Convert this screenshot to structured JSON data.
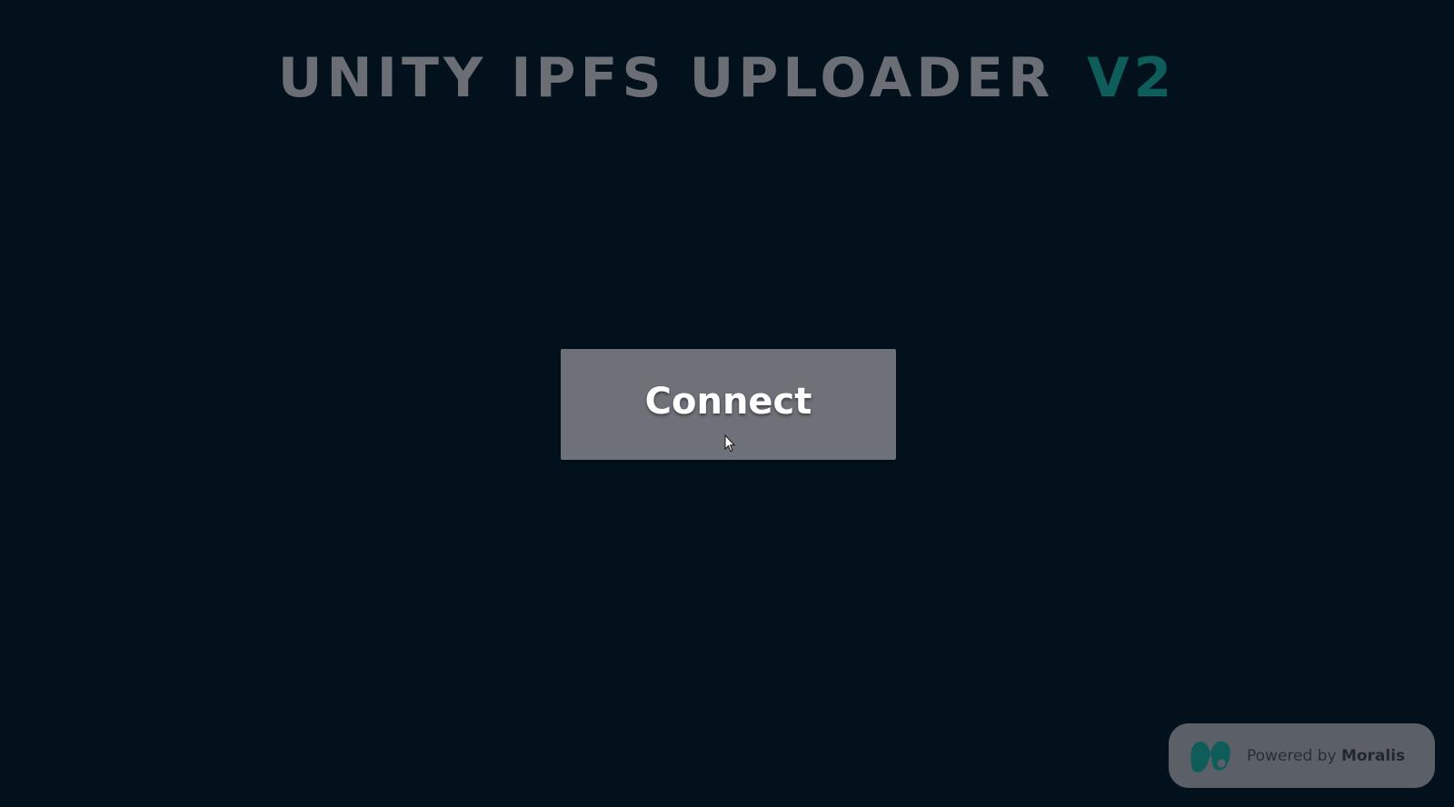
{
  "header": {
    "title": "UNITY IPFS UPLOADER",
    "version": "V2"
  },
  "main": {
    "connect_label": "Connect"
  },
  "badge": {
    "powered_by": "Powered by",
    "brand": "Moralis",
    "logo_icon": "moralis-logo-icon"
  },
  "colors": {
    "background": "#02111b",
    "title": "#6b6e74",
    "version_accent": "#0e5d5b",
    "button": "#6e7177",
    "badge": "#5b5f66"
  }
}
